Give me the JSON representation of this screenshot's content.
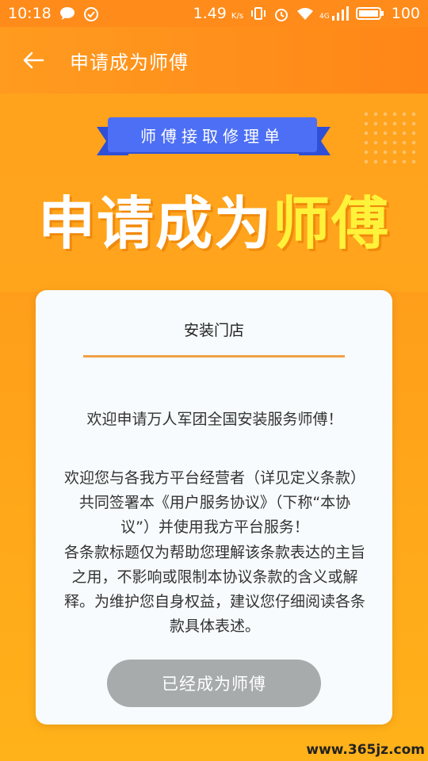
{
  "status_bar": {
    "time": "10:18",
    "speed": "1.49",
    "speed_unit": "K/s",
    "network": "4G",
    "battery": "100"
  },
  "app_bar": {
    "title": "申请成为师傅"
  },
  "hero": {
    "ribbon_text": "师傅接取修理单",
    "title_prefix": "申请成为",
    "title_highlight": "师傅"
  },
  "card": {
    "heading": "安装门店",
    "paragraphs": [
      "欢迎申请万人军团全国安装服务师傅！",
      "欢迎您与各我方平台经营者（详见定义条款）共同签署本《用户服务协议》（下称“本协议”）并使用我方平台服务！",
      "各条款标题仅为帮助您理解该条款表达的主旨之用，不影响或限制本协议条款的含义或解释。为维护您自身权益，建议您仔细阅读各条款具体表述。"
    ],
    "status_button": "已经成为师傅"
  },
  "watermark": "www.365jz.com",
  "colors": {
    "primary_orange": "#ff8b1a",
    "highlight_yellow": "#fff23a",
    "ribbon_blue": "#4d6ff5",
    "divider": "#f0a048",
    "button_disabled": "#a8abac"
  }
}
